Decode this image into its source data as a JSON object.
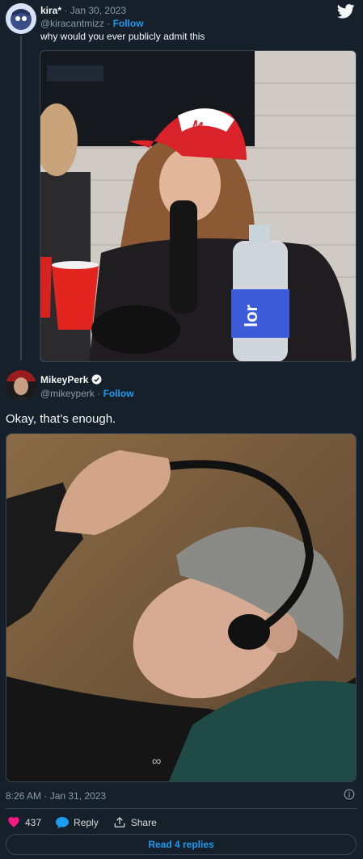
{
  "tweet_quoted": {
    "author_name": "kira*",
    "date": "· Jan 30, 2023",
    "handle": "@kiracantmizz",
    "follow_label": "Follow",
    "text": "why would you ever publicly admit this"
  },
  "tweet_main": {
    "author_name": "MikeyPerk",
    "handle": "@mikeyperk",
    "follow_label": "Follow",
    "text": "Okay, that’s enough.",
    "timestamp": "8:26 AM · Jan 31, 2023"
  },
  "actions": {
    "like_count": "437",
    "reply_label": "Reply",
    "share_label": "Share"
  },
  "read_replies_label": "Read 4 replies",
  "colors": {
    "background": "#15202b",
    "accent": "#1d9bf0",
    "like": "#f91880"
  }
}
